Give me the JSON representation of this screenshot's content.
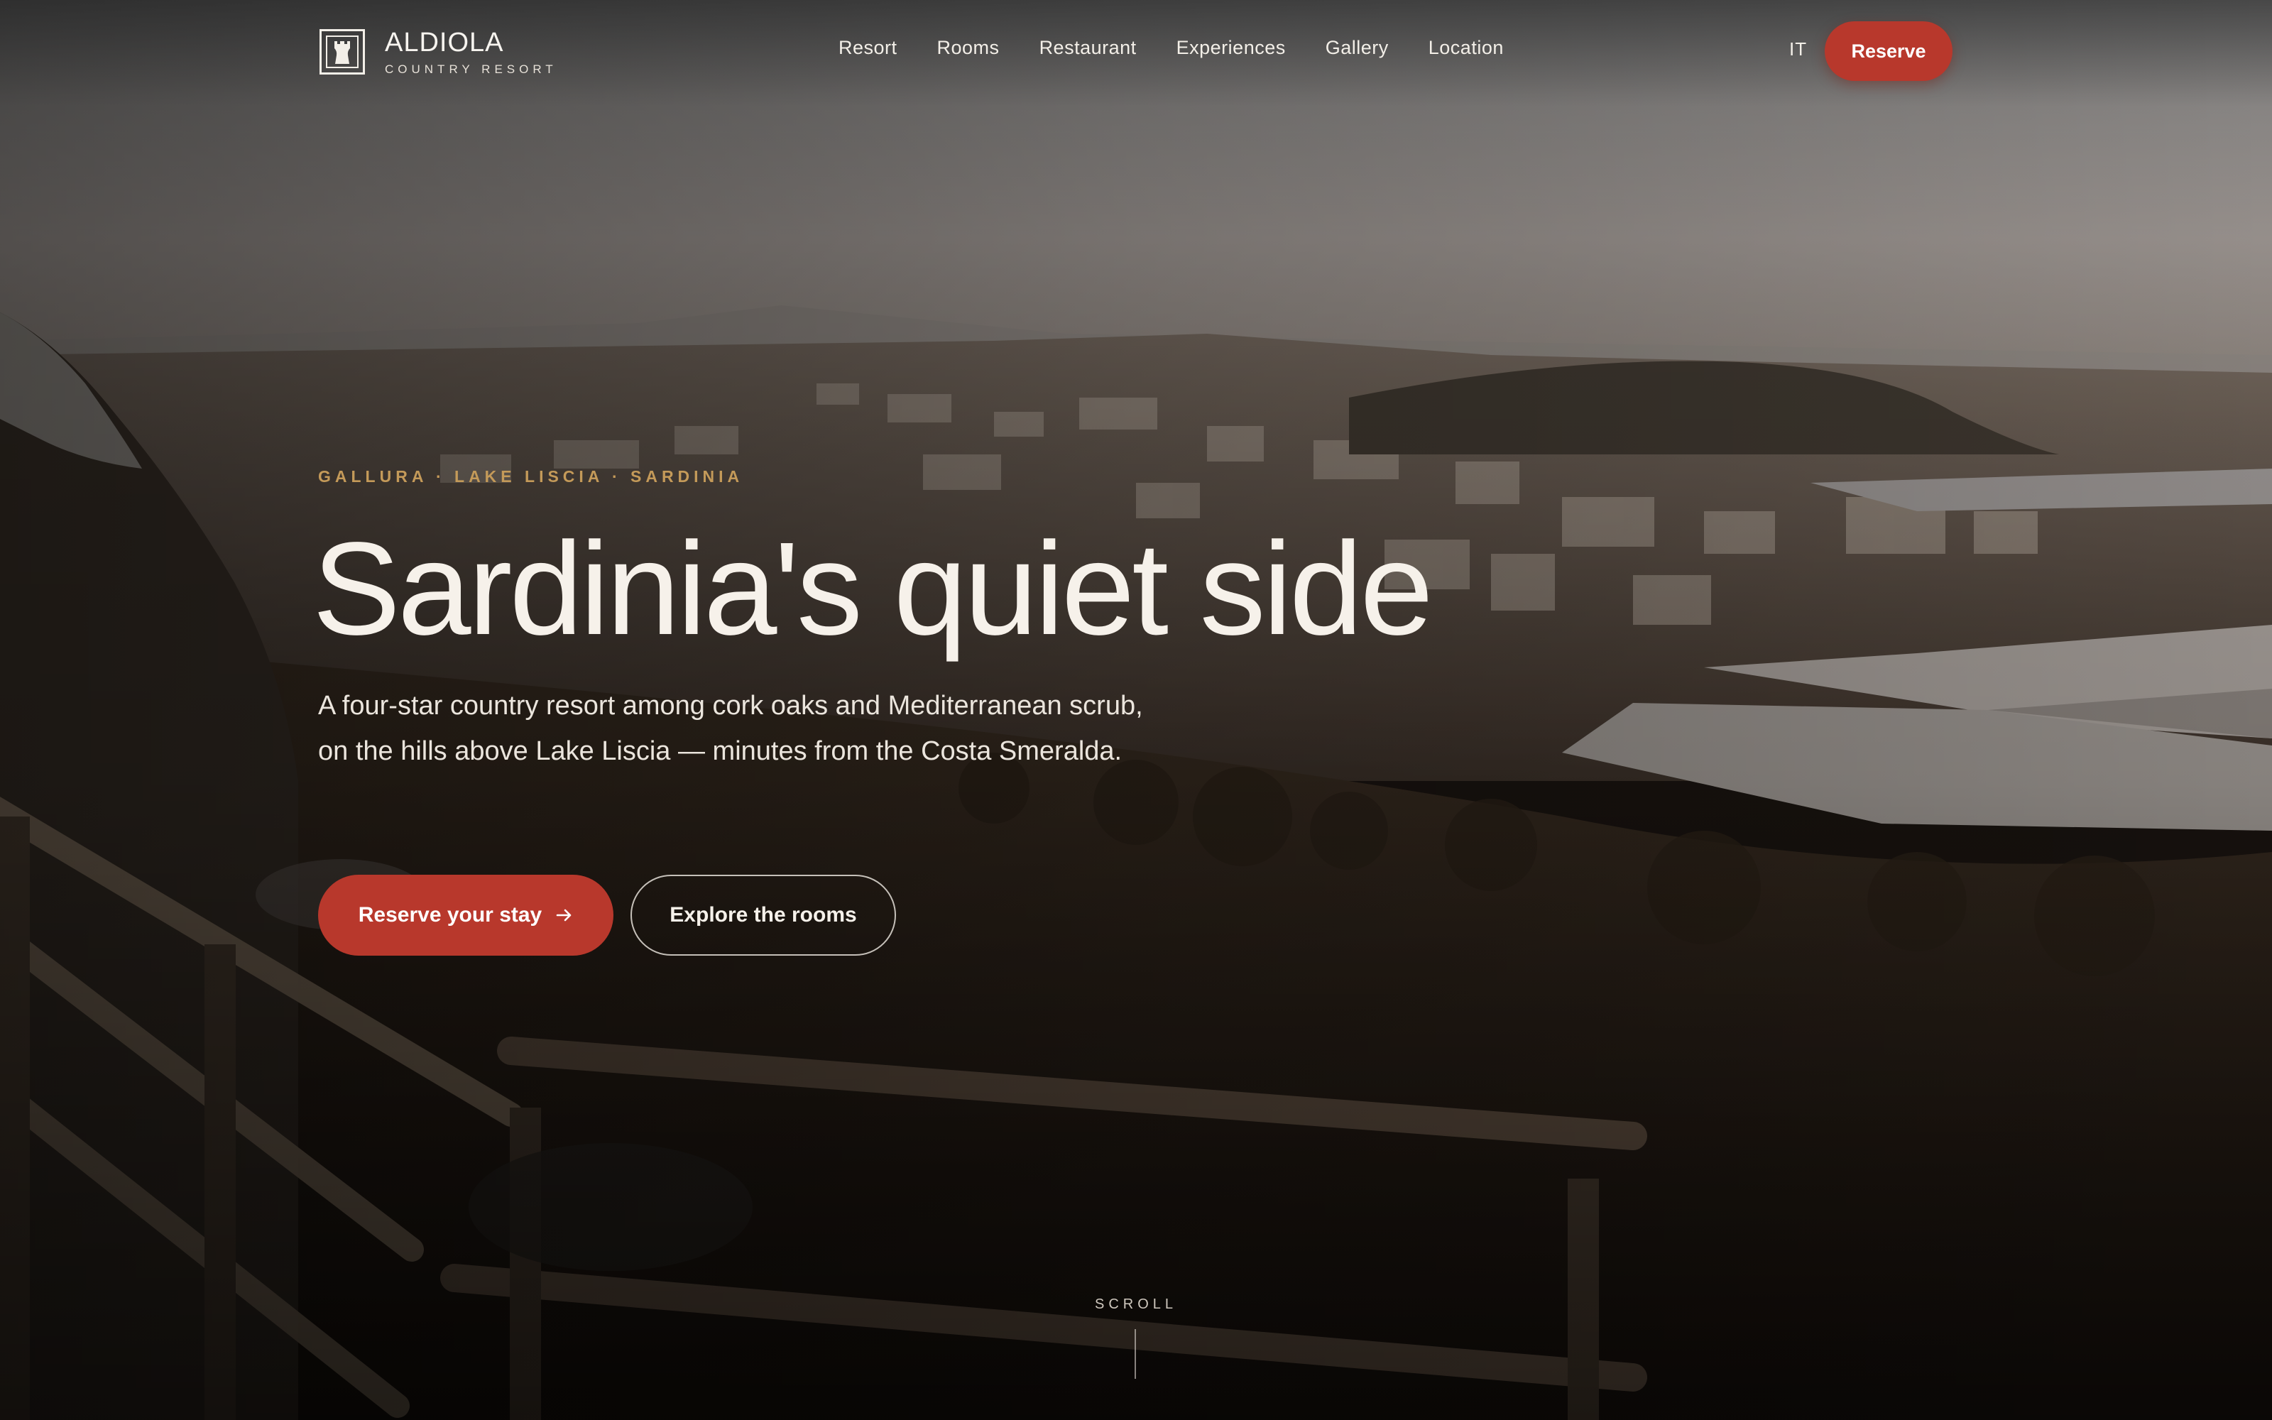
{
  "brand": {
    "name": "ALDIOLA",
    "tagline": "COUNTRY RESORT"
  },
  "nav": {
    "items": [
      {
        "label": "Resort"
      },
      {
        "label": "Rooms"
      },
      {
        "label": "Restaurant"
      },
      {
        "label": "Experiences"
      },
      {
        "label": "Gallery"
      },
      {
        "label": "Location"
      }
    ],
    "language": "IT",
    "reserve_label": "Reserve"
  },
  "hero": {
    "eyebrow": "GALLURA · LAKE LISCIA · SARDINIA",
    "title": "Sardinia's quiet side",
    "description": "A four-star country resort among cork oaks and Mediterranean scrub, on the hills above Lake Liscia — minutes from the Costa Smeralda.",
    "primary_cta": "Reserve your stay",
    "primary_cta_icon": "arrow-right-icon",
    "secondary_cta": "Explore the rooms",
    "scroll_label": "SCROLL"
  },
  "colors": {
    "accent": "#b8382c",
    "eyebrow": "#c49a59",
    "text_light": "#f6f1ea"
  }
}
